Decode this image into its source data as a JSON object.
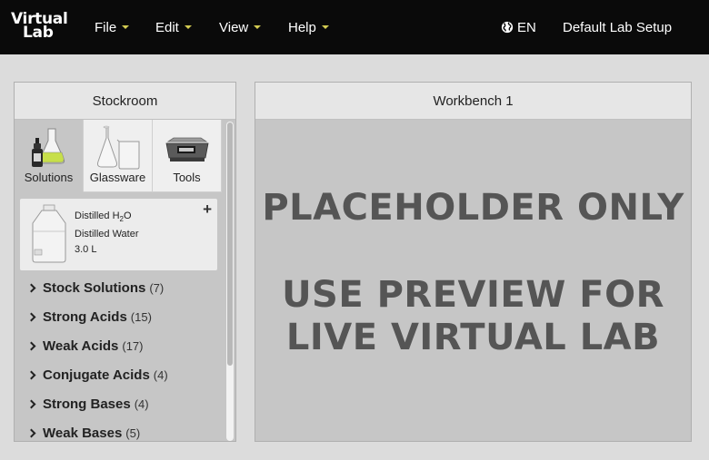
{
  "navbar": {
    "logo_line1": "Virtual",
    "logo_line2": "Lab",
    "menus": [
      {
        "label": "File"
      },
      {
        "label": "Edit"
      },
      {
        "label": "View"
      },
      {
        "label": "Help"
      }
    ],
    "language": "EN",
    "setup": "Default Lab Setup",
    "accent_color": "#d4cc52"
  },
  "stockroom": {
    "title": "Stockroom",
    "tabs": [
      {
        "label": "Solutions",
        "icon": "solutions-icon",
        "active": true
      },
      {
        "label": "Glassware",
        "icon": "glassware-icon",
        "active": false
      },
      {
        "label": "Tools",
        "icon": "scale-icon",
        "active": false
      }
    ],
    "item": {
      "formula_prefix": "Distilled H",
      "formula_sub": "2",
      "formula_suffix": "O",
      "name": "Distilled Water",
      "volume": "3.0 L"
    },
    "categories": [
      {
        "label": "Stock Solutions",
        "count": "(7)"
      },
      {
        "label": "Strong Acids",
        "count": "(15)"
      },
      {
        "label": "Weak Acids",
        "count": "(17)"
      },
      {
        "label": "Conjugate Acids",
        "count": "(4)"
      },
      {
        "label": "Strong Bases",
        "count": "(4)"
      },
      {
        "label": "Weak Bases",
        "count": "(5)"
      }
    ]
  },
  "workbench": {
    "title": "Workbench 1",
    "line1": "PLACEHOLDER ONLY",
    "line2": "USE PREVIEW FOR",
    "line3": "LIVE VIRTUAL LAB"
  }
}
